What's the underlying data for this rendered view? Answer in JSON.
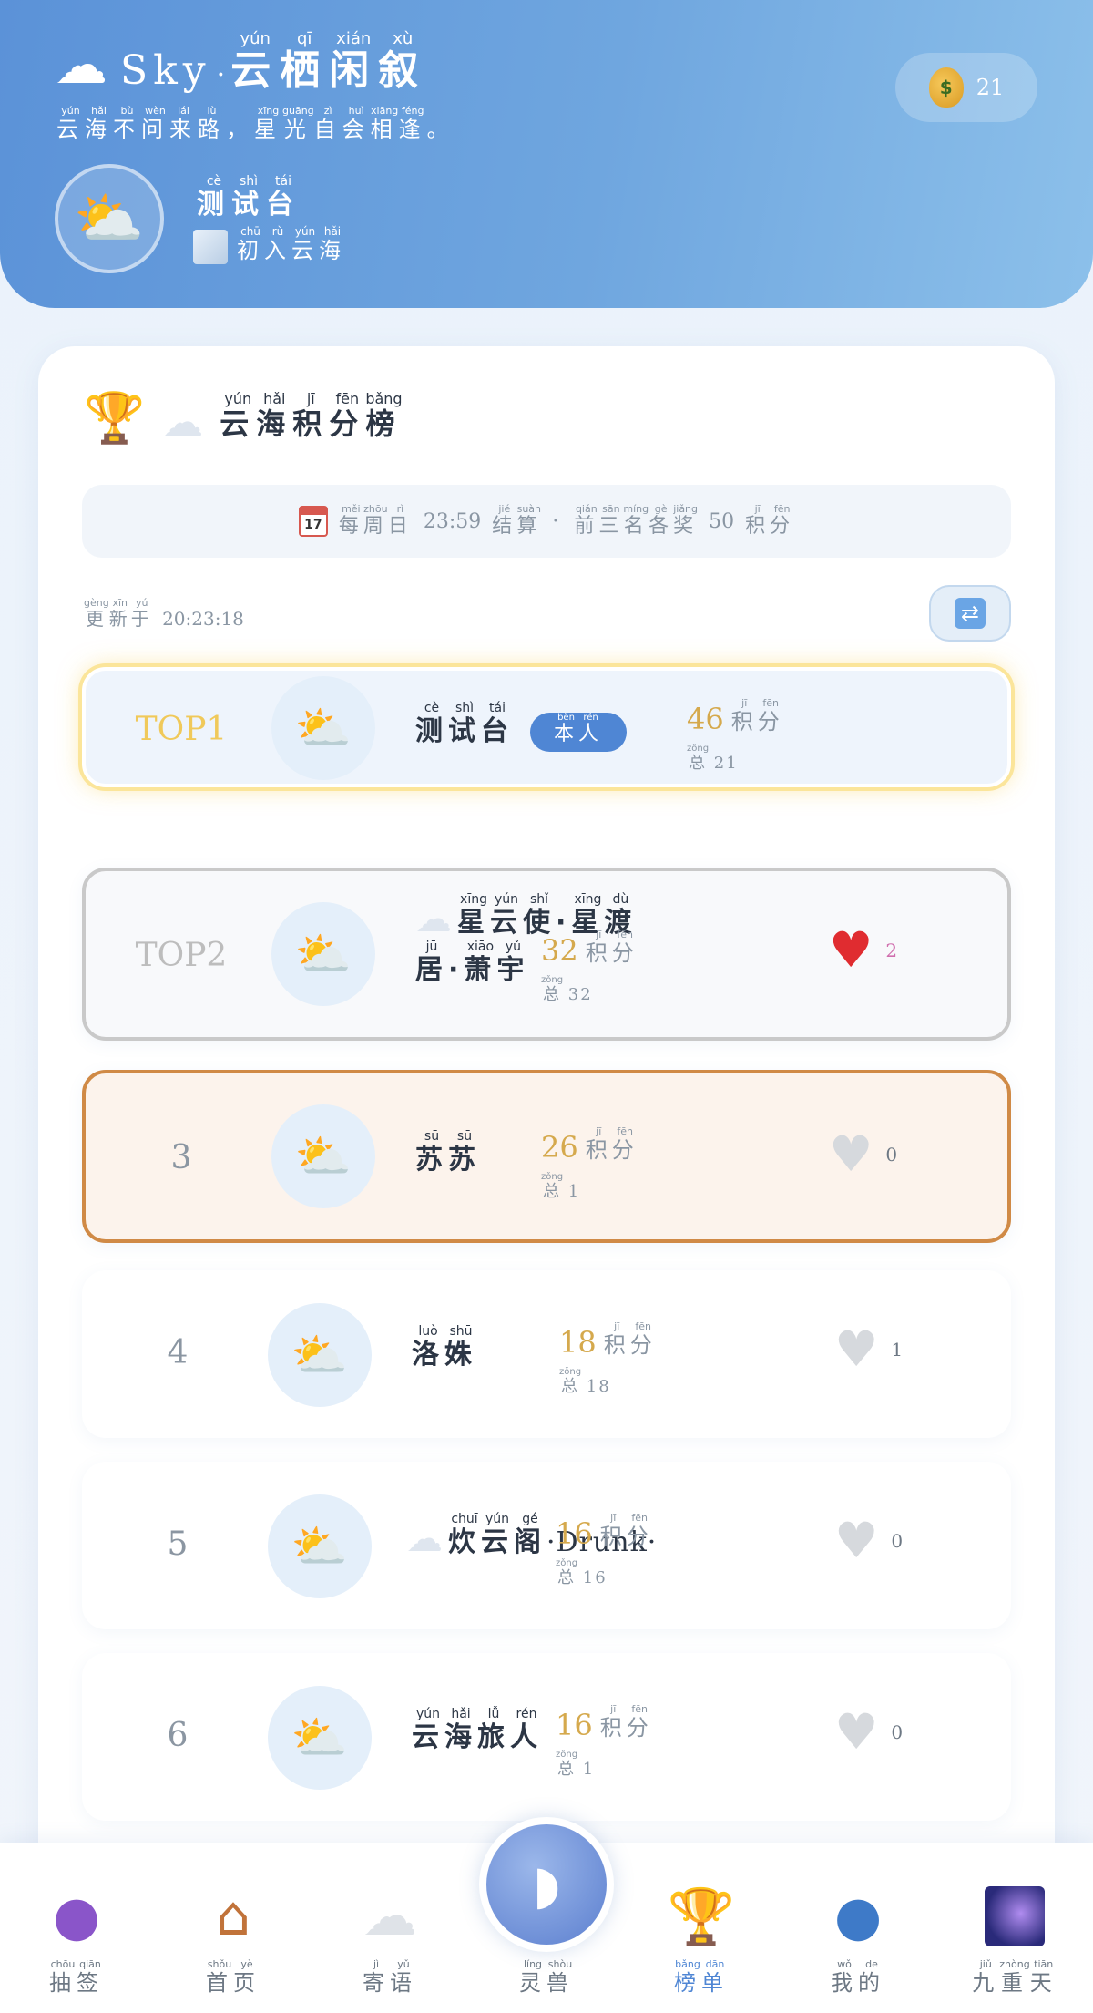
{
  "header": {
    "brand_latin": "Sky",
    "brand_dot": "·",
    "brand_name": [
      [
        "云",
        "yún"
      ],
      [
        "栖",
        "qī"
      ],
      [
        "闲",
        "xián"
      ],
      [
        "叙",
        "xù"
      ]
    ],
    "tagline": [
      [
        "云",
        "yún"
      ],
      [
        "海",
        "hǎi"
      ],
      [
        "不",
        "bù"
      ],
      [
        "问",
        "wèn"
      ],
      [
        "来",
        "lái"
      ],
      [
        "路",
        "lù"
      ],
      [
        "，",
        ""
      ],
      [
        "星",
        "xīng"
      ],
      [
        "光",
        "guāng"
      ],
      [
        "自",
        "zì"
      ],
      [
        "会",
        "huì"
      ],
      [
        "相",
        "xiāng"
      ],
      [
        "逢",
        "féng"
      ],
      [
        "。",
        ""
      ]
    ],
    "coins": "21",
    "profile_name": [
      [
        "测",
        "cè"
      ],
      [
        "试",
        "shì"
      ],
      [
        "台",
        "tái"
      ]
    ],
    "profile_rank": [
      [
        "初",
        "chū"
      ],
      [
        "入",
        "rù"
      ],
      [
        "云",
        "yún"
      ],
      [
        "海",
        "hǎi"
      ]
    ]
  },
  "board": {
    "title": [
      [
        "云",
        "yún"
      ],
      [
        "海",
        "hǎi"
      ],
      [
        "积",
        "jī"
      ],
      [
        "分",
        "fēn"
      ],
      [
        "榜",
        "bǎng"
      ]
    ],
    "calendar_day": "17",
    "notice_a": [
      [
        "每",
        "měi"
      ],
      [
        "周",
        "zhōu"
      ],
      [
        "日",
        "rì"
      ]
    ],
    "notice_time": "23:59",
    "notice_b": [
      [
        "结",
        "jié"
      ],
      [
        "算",
        "suàn"
      ]
    ],
    "notice_dot": "·",
    "notice_c": [
      [
        "前",
        "qián"
      ],
      [
        "三",
        "sān"
      ],
      [
        "名",
        "míng"
      ],
      [
        "各",
        "gè"
      ],
      [
        "奖",
        "jiǎng"
      ]
    ],
    "notice_num": "50",
    "notice_d": [
      [
        "积",
        "jī"
      ],
      [
        "分",
        "fēn"
      ]
    ],
    "updated_prefix": [
      [
        "更",
        "gèng"
      ],
      [
        "新",
        "xīn"
      ],
      [
        "于",
        "yú"
      ]
    ],
    "updated_time": "20:23:18"
  },
  "unit_points": [
    [
      "积",
      "jī"
    ],
    [
      "分",
      "fēn"
    ]
  ],
  "unit_total": [
    [
      "总",
      "zǒng"
    ]
  ],
  "self_badge": [
    [
      "本",
      "běn"
    ],
    [
      "人",
      "rén"
    ]
  ],
  "rows": [
    {
      "rank": "TOP1",
      "name": [
        [
          "测",
          "cè"
        ],
        [
          "试",
          "shì"
        ],
        [
          "台",
          "tái"
        ]
      ],
      "score": "46",
      "total": "21",
      "likes": null
    },
    {
      "rank": "TOP2",
      "name_line1": [
        [
          "星",
          "xīng"
        ],
        [
          "云",
          "yún"
        ],
        [
          "使",
          "shǐ"
        ],
        [
          "·",
          ""
        ],
        [
          "星",
          "xīng"
        ],
        [
          "渡",
          "dù"
        ]
      ],
      "name_line2": [
        [
          "居",
          "jū"
        ],
        [
          "·",
          ""
        ],
        [
          "萧",
          "xiāo"
        ],
        [
          "宇",
          "yǔ"
        ]
      ],
      "score": "32",
      "total": "32",
      "likes": "2"
    },
    {
      "rank": "3",
      "name": [
        [
          "苏",
          "sū"
        ],
        [
          "苏",
          "sū"
        ]
      ],
      "score": "26",
      "total": "1",
      "likes": "0"
    },
    {
      "rank": "4",
      "name": [
        [
          "洛",
          "luò"
        ],
        [
          "姝",
          "shū"
        ]
      ],
      "score": "18",
      "total": "18",
      "likes": "1"
    },
    {
      "rank": "5",
      "name": [
        [
          "炊",
          "chuī"
        ],
        [
          "云",
          "yún"
        ],
        [
          "阁",
          "gé"
        ]
      ],
      "name_latin": "·Drunk·",
      "score": "16",
      "total": "16",
      "likes": "0"
    },
    {
      "rank": "6",
      "name": [
        [
          "云",
          "yún"
        ],
        [
          "海",
          "hǎi"
        ],
        [
          "旅",
          "lǚ"
        ],
        [
          "人",
          "rén"
        ]
      ],
      "score": "16",
      "total": "1",
      "likes": "0"
    }
  ],
  "nav": [
    {
      "label": [
        [
          "抽",
          "chōu"
        ],
        [
          "签",
          "qiān"
        ]
      ],
      "icon": "crystal-ball-icon"
    },
    {
      "label": [
        [
          "首",
          "shǒu"
        ],
        [
          "页",
          "yè"
        ]
      ],
      "icon": "house-icon"
    },
    {
      "label": [
        [
          "寄",
          "jì"
        ],
        [
          "语",
          "yǔ"
        ]
      ],
      "icon": "cloud-icon"
    },
    {
      "label": [
        [
          "灵",
          "líng"
        ],
        [
          "兽",
          "shòu"
        ]
      ],
      "icon": "whale-icon"
    },
    {
      "label": [
        [
          "榜",
          "bǎng"
        ],
        [
          "单",
          "dān"
        ]
      ],
      "icon": "trophy-icon"
    },
    {
      "label": [
        [
          "我",
          "wǒ"
        ],
        [
          "的",
          "de"
        ]
      ],
      "icon": "person-icon"
    },
    {
      "label": [
        [
          "九",
          "jiǔ"
        ],
        [
          "重",
          "zhòng"
        ],
        [
          "天",
          "tiān"
        ]
      ],
      "icon": "galaxy-icon"
    }
  ],
  "colors": {
    "header_start": "#5b92d8",
    "accent": "#4f86d4",
    "gold": "#f0c95a",
    "score": "#d5a94d",
    "bronze": "#d08a46"
  }
}
